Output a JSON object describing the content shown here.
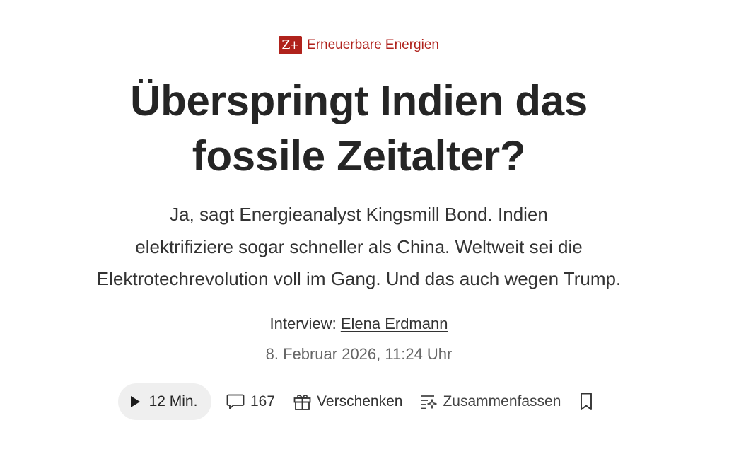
{
  "article": {
    "zplus_badge": "Z+",
    "kicker": "Erneuerbare Energien",
    "headline_lines": [
      "Überspringt Indien das",
      "fossile Zeitalter?"
    ],
    "teaser_lines": [
      "Ja, sagt Energieanalyst Kingsmill Bond. Indien",
      "elektrifiziere sogar schneller als China. Weltweit sei die",
      "Elektrotechrevolution voll im Gang. Und das auch wegen Trump."
    ],
    "byline_prefix": "Interview:",
    "author": "Elena Erdmann",
    "date": "8. Februar 2026, 11:24 Uhr"
  },
  "actions": {
    "listen_icon": "play-icon",
    "listen_label": "12 Min.",
    "comments_icon": "comment-bubble-icon",
    "comments_count": "167",
    "gift_icon": "gift-icon",
    "gift_label": "Verschenken",
    "summary_icon": "summarize-icon",
    "summary_label": "Zusammenfassen",
    "bookmark_icon": "bookmark-icon"
  },
  "colors": {
    "accent_red": "#b0221c",
    "text_dark": "#252525",
    "text_muted": "#666666",
    "pill_bg": "#efefef"
  }
}
